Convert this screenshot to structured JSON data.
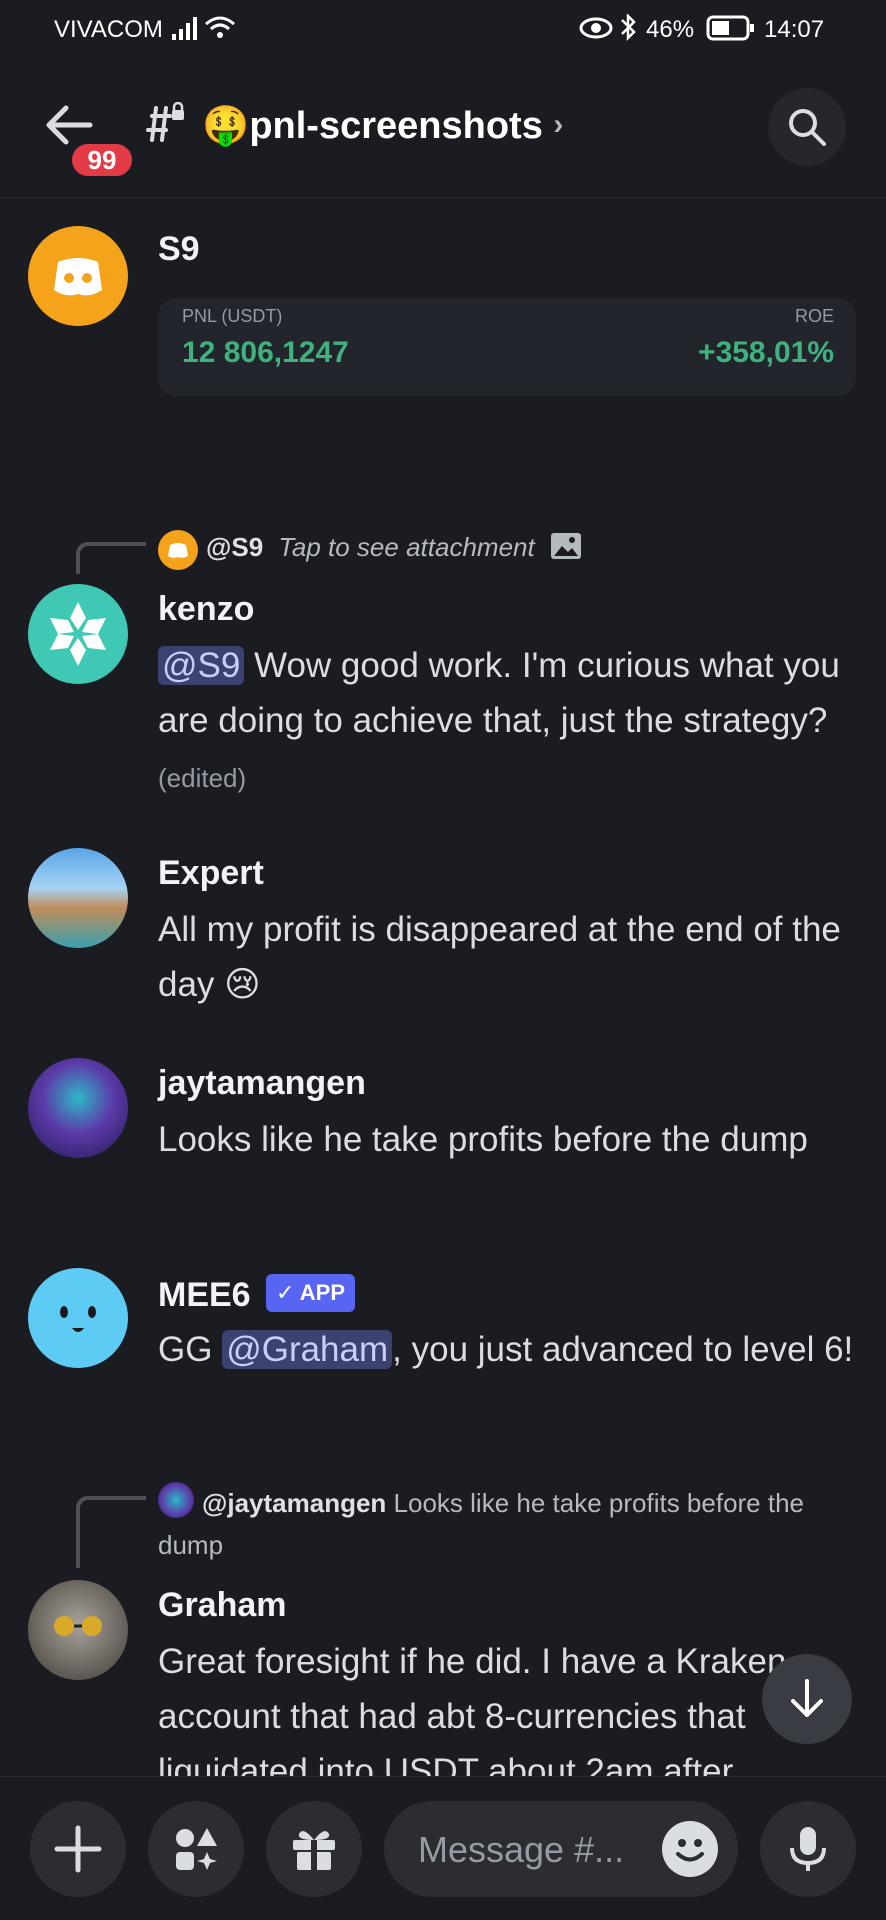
{
  "status_bar": {
    "carrier": "VIVACOM",
    "battery": "46%",
    "time": "14:07"
  },
  "header": {
    "unread_badge": "99",
    "channel_emoji": "🤑",
    "channel_name": "pnl-screenshots",
    "chevron": "›"
  },
  "messages": [
    {
      "author": "S9",
      "avatar_icon": "discord-logo-icon",
      "avatar_color": "#f6a31c",
      "embed": {
        "left_label": "PNL (USDT)",
        "left_value": "12 806,1247",
        "right_label": "ROE",
        "right_value": "+358,01%",
        "value_color": "#3fb27f"
      }
    },
    {
      "reply_to": {
        "mention": "@S9",
        "text": "Tap to see attachment"
      },
      "author": "kenzo",
      "avatar_color": "#3fc8b3",
      "mention": "@S9",
      "text": " Wow good work. I'm curious what you are doing to achieve that, just the strategy?",
      "edited": "(edited)"
    },
    {
      "author": "Expert",
      "text": "All my profit is disappeared at the end of the day 😢"
    },
    {
      "author": "jaytamangen",
      "text": "Looks like he take profits before the dump"
    },
    {
      "author": "MEE6",
      "avatar_color": "#5ecbf5",
      "app_badge": "✓ APP",
      "text_before": "GG ",
      "mention": "@Graham",
      "text_after": ", you just advanced to level 6!"
    },
    {
      "reply_to": {
        "mention": "@jaytamangen",
        "text": "Looks like he take profits before the dump"
      },
      "author": "Graham",
      "text": "Great foresight if he did. I have a Kraken account that had abt 8-currencies that liquidated into USDT about 2am after"
    }
  ],
  "composer": {
    "placeholder": "Message #..."
  },
  "colors": {
    "background": "#1b1c21",
    "mention_bg": "#3c4270",
    "badge_red": "#e23b46",
    "app_badge": "#5865f2"
  }
}
